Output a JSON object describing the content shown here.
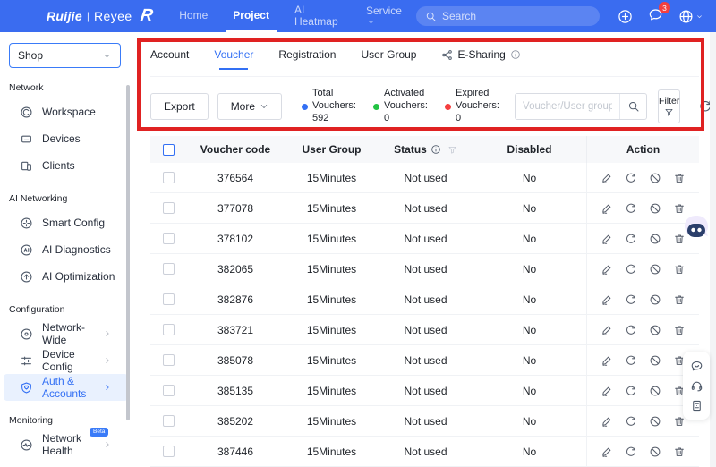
{
  "navbar": {
    "brand": {
      "primary": "Ruijie",
      "separator": "|",
      "secondary": "Reyee",
      "logo_glyph": "R"
    },
    "menu": [
      {
        "label": "Home",
        "active": false,
        "caret": false
      },
      {
        "label": "Project",
        "active": true,
        "caret": false
      },
      {
        "label": "AI Heatmap",
        "active": false,
        "caret": false,
        "wrap": true
      },
      {
        "label": "Service",
        "active": false,
        "caret": true
      }
    ],
    "search_placeholder": "Search",
    "notification_count": "3"
  },
  "sidebar": {
    "org_selector_value": "Shop",
    "sections": [
      {
        "title": "Network",
        "items": [
          {
            "label": "Workspace",
            "icon": "workspace"
          },
          {
            "label": "Devices",
            "icon": "devices"
          },
          {
            "label": "Clients",
            "icon": "clients"
          }
        ]
      },
      {
        "title": "AI Networking",
        "items": [
          {
            "label": "Smart Config",
            "icon": "smart-config"
          },
          {
            "label": "AI Diagnostics",
            "icon": "ai-diagnostics"
          },
          {
            "label": "AI Optimization",
            "icon": "ai-optimization"
          }
        ]
      },
      {
        "title": "Configuration",
        "items": [
          {
            "label": "Network-Wide",
            "icon": "network-wide",
            "arrow": true
          },
          {
            "label": "Device Config",
            "icon": "device-config",
            "arrow": true
          },
          {
            "label": "Auth & Accounts",
            "icon": "auth-accounts",
            "arrow": true,
            "active": true
          }
        ]
      },
      {
        "title": "Monitoring",
        "items": [
          {
            "label": "Network Health",
            "icon": "network-health",
            "arrow": true,
            "badge": "Beta"
          }
        ]
      }
    ]
  },
  "main": {
    "tabs": [
      {
        "label": "Account",
        "active": false
      },
      {
        "label": "Voucher",
        "active": true
      },
      {
        "label": "Registration",
        "active": false
      },
      {
        "label": "User Group",
        "active": false
      },
      {
        "label": "E-Sharing",
        "active": false,
        "icon": "share",
        "info": true
      }
    ],
    "toolbar": {
      "export_label": "Export",
      "more_label": "More",
      "stats": [
        {
          "label": "Total Vouchers:",
          "value": "592",
          "color": "#3370f4"
        },
        {
          "label": "Activated Vouchers:",
          "value": "0",
          "color": "#23c343"
        },
        {
          "label": "Expired Vouchers:",
          "value": "0",
          "color": "#f53f3f"
        }
      ],
      "search_placeholder": "Voucher/User group",
      "filter_label": "Filter"
    },
    "table": {
      "columns": [
        "Voucher code",
        "User Group",
        "Status",
        "Disabled",
        "Action"
      ],
      "rows": [
        {
          "code": "376564",
          "group": "15Minutes",
          "status": "Not used",
          "disabled": "No"
        },
        {
          "code": "377078",
          "group": "15Minutes",
          "status": "Not used",
          "disabled": "No"
        },
        {
          "code": "378102",
          "group": "15Minutes",
          "status": "Not used",
          "disabled": "No"
        },
        {
          "code": "382065",
          "group": "15Minutes",
          "status": "Not used",
          "disabled": "No"
        },
        {
          "code": "382876",
          "group": "15Minutes",
          "status": "Not used",
          "disabled": "No"
        },
        {
          "code": "383721",
          "group": "15Minutes",
          "status": "Not used",
          "disabled": "No"
        },
        {
          "code": "385078",
          "group": "15Minutes",
          "status": "Not used",
          "disabled": "No"
        },
        {
          "code": "385135",
          "group": "15Minutes",
          "status": "Not used",
          "disabled": "No"
        },
        {
          "code": "385202",
          "group": "15Minutes",
          "status": "Not used",
          "disabled": "No"
        },
        {
          "code": "387446",
          "group": "15Minutes",
          "status": "Not used",
          "disabled": "No"
        }
      ],
      "row_action_icons": [
        "edit",
        "refresh",
        "ban",
        "trash"
      ]
    }
  },
  "colors": {
    "navbar": "#3a6cf0",
    "accent": "#3370f4",
    "annotation_red": "#e02222",
    "badge_red": "#f53f3f",
    "dot_total": "#3370f4",
    "dot_activated": "#23c343",
    "dot_expired": "#f53f3f"
  }
}
